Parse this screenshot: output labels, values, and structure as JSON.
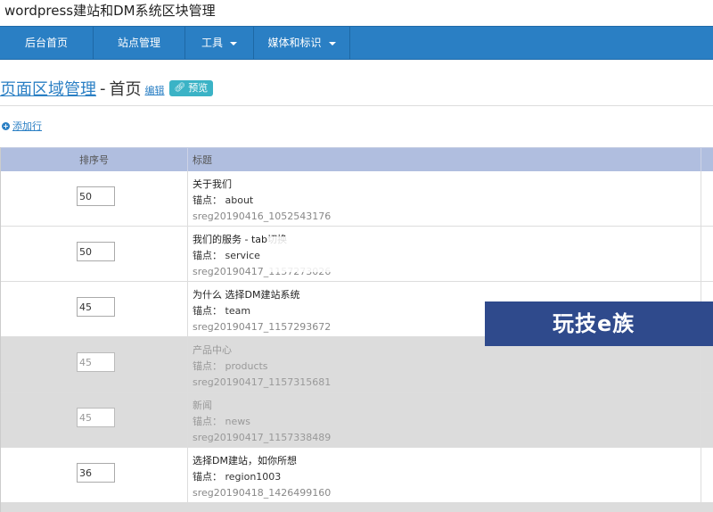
{
  "site": {
    "title": "wordpress建站和DM系统区块管理"
  },
  "nav": {
    "items": [
      {
        "label": "后台首页",
        "has_caret": false
      },
      {
        "label": "站点管理",
        "has_caret": false
      },
      {
        "label": "工具",
        "has_caret": true
      },
      {
        "label": "媒体和标识",
        "has_caret": true
      }
    ]
  },
  "header": {
    "breadcrumb_link": "页面区域管理",
    "separator": "-",
    "current": "首页",
    "edit_label": "编辑",
    "preview_label": "预览"
  },
  "toolbar": {
    "add_row_label": "添加行"
  },
  "table": {
    "columns": [
      "排序号",
      "标题"
    ],
    "anchor_prefix": "锚点：",
    "rows": [
      {
        "sort": "50",
        "title": "关于我们",
        "anchor": "about",
        "id": "sreg20190416_1052543176",
        "disabled": false
      },
      {
        "sort": "50",
        "title": "我们的服务 - tab切换",
        "anchor": "service",
        "id": "sreg20190417_1157273026",
        "disabled": false
      },
      {
        "sort": "45",
        "title": "为什么 选择DM建站系统",
        "anchor": "team",
        "id": "sreg20190417_1157293672",
        "disabled": false
      },
      {
        "sort": "45",
        "title": "产品中心",
        "anchor": "products",
        "id": "sreg20190417_1157315681",
        "disabled": true
      },
      {
        "sort": "45",
        "title": "新闻",
        "anchor": "news",
        "id": "sreg20190417_1157338489",
        "disabled": true
      },
      {
        "sort": "36",
        "title": "选择DM建站，如你所想",
        "anchor": "region1003",
        "id": "sreg20190418_1426499160",
        "disabled": false
      }
    ]
  },
  "watermark": {
    "text": "玩技e族"
  },
  "colors": {
    "nav_bg": "#2a7fc4",
    "header_row_bg": "#b0bedf",
    "disabled_row_bg": "#dcdcdc",
    "preview_btn": "#3bb3c6",
    "watermark_bg": "#2f4a8c"
  }
}
